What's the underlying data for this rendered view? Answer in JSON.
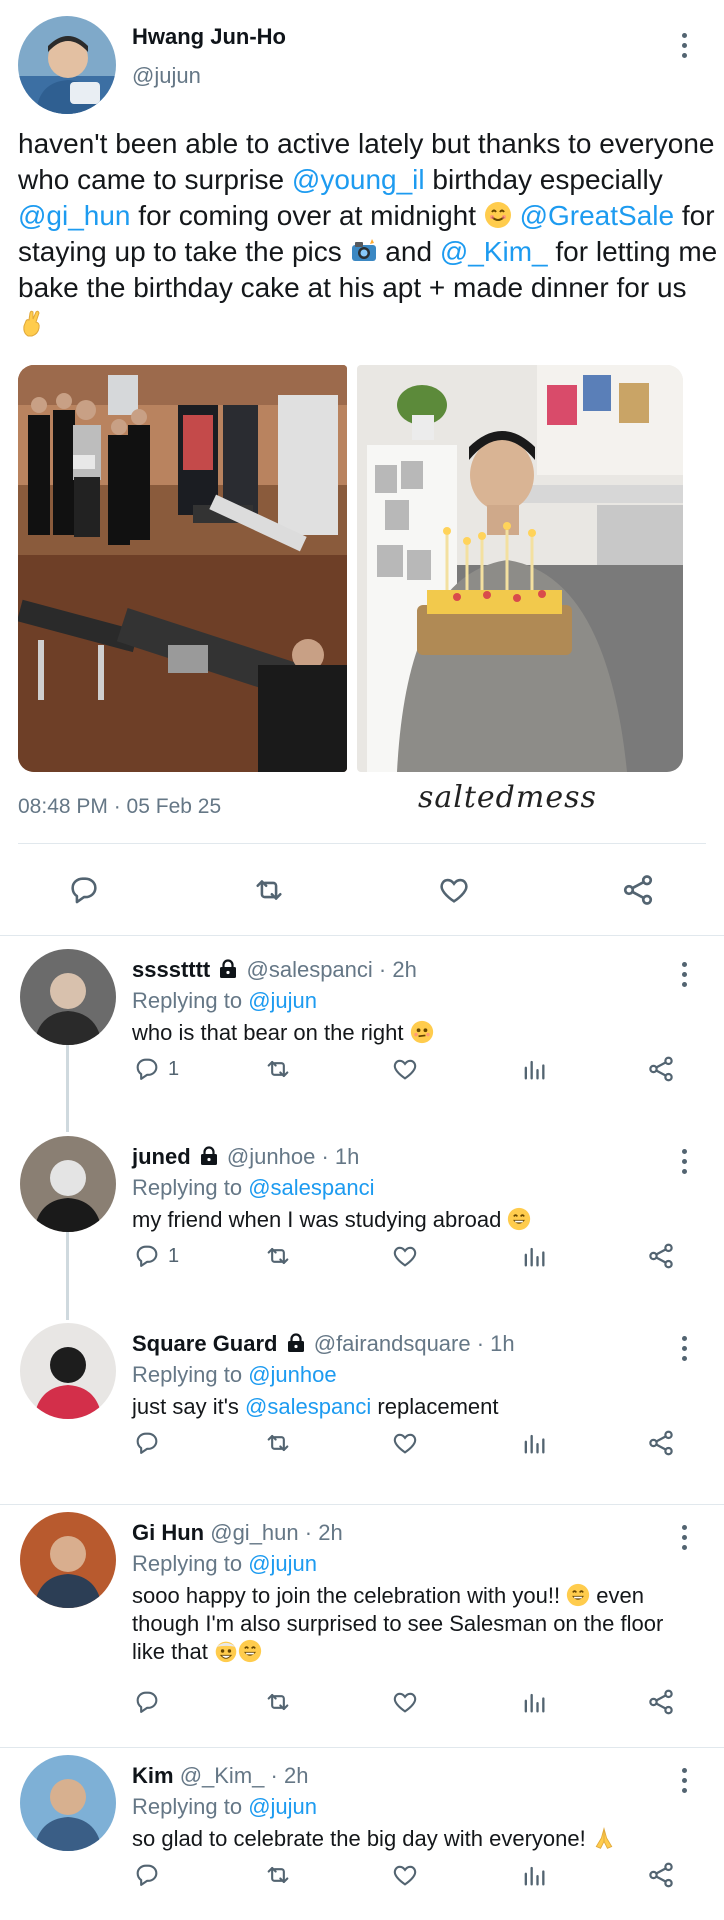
{
  "main": {
    "name": "Hwang Jun-Ho",
    "handle": "@jujun",
    "text_1": "haven't been able to active lately but thanks to everyone who came to surprise ",
    "mention_1": "@young_il",
    "text_2": " birthday especially ",
    "mention_2": "@gi_hun",
    "text_3": " for coming over at midnight ",
    "mention_3": "@GreatSale",
    "text_4": " for staying up to take the pics ",
    "text_5": " and ",
    "mention_4": "@_Kim_",
    "text_6": " for letting me bake the birthday cake at his apt + made dinner for us ",
    "timestamp": "08:48 PM · 05 Feb 25",
    "watermark": "saltedmess"
  },
  "replies": [
    {
      "name": "sssstttt",
      "handle": "@salespanci",
      "time": "· 2h",
      "replying_label": "Replying to ",
      "replying_to": "@jujun",
      "text_before": "who is that bear on the right ",
      "mention": "",
      "text_after": "",
      "reply_count": "1"
    },
    {
      "name": "juned",
      "handle": "@junhoe",
      "time": "· 1h",
      "replying_label": "Replying to ",
      "replying_to": "@salespanci",
      "text_before": "my friend when I was studying abroad ",
      "mention": "",
      "text_after": "",
      "reply_count": "1"
    },
    {
      "name": "Square Guard",
      "handle": "@fairandsquare",
      "time": "· 1h",
      "replying_label": "Replying to ",
      "replying_to": "@junhoe",
      "text_before": "just say it's ",
      "mention": "@salespanci",
      "text_after": " replacement",
      "reply_count": ""
    },
    {
      "name": "Gi Hun",
      "handle": "@gi_hun",
      "time": "· 2h",
      "replying_label": "Replying to ",
      "replying_to": "@jujun",
      "text_before": "sooo happy to join the celebration with you!! ",
      "mention": "",
      "text_after": " even though I'm also surprised to see Salesman on the floor like that ",
      "reply_count": ""
    },
    {
      "name": "Kim",
      "handle": "@_Kim_",
      "time": "· 2h",
      "replying_label": "Replying to ",
      "replying_to": "@jujun",
      "text_before": "so glad to celebrate the big day with everyone! ",
      "mention": "",
      "text_after": "",
      "reply_count": ""
    }
  ],
  "icons": [
    "more-vertical-icon",
    "reply-icon",
    "retweet-icon",
    "like-icon",
    "views-icon",
    "share-icon",
    "lock-icon"
  ],
  "colors": {
    "link": "#1d9bf0",
    "muted": "#657786",
    "divider": "#e1e8ed"
  }
}
